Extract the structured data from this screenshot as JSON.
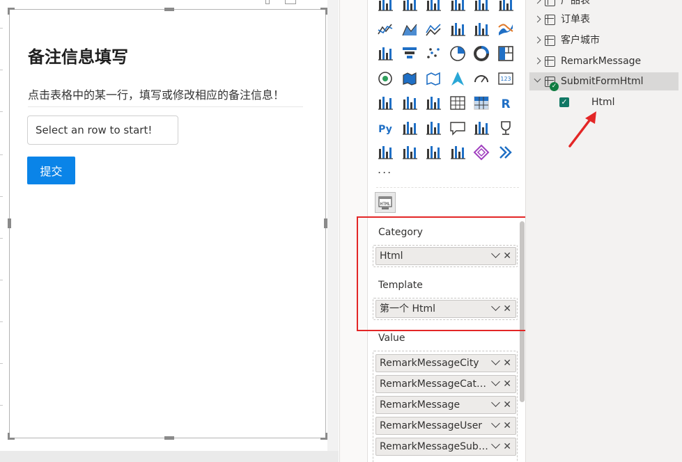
{
  "form": {
    "title": "备注信息填写",
    "instruction": "点击表格中的某一行，填写或修改相应的备注信息！",
    "input_value": "Select an row to start!",
    "submit_label": "提交"
  },
  "visualizations": {
    "more_label": "...",
    "icons": [
      "stacked-bar-icon",
      "stacked-column-icon",
      "clustered-bar-icon",
      "clustered-column-icon",
      "100-bar-icon",
      "100-column-icon",
      "line-chart-icon",
      "area-chart-icon",
      "stacked-area-icon",
      "line-column-icon",
      "line-clustered-column-icon",
      "ribbon-chart-icon",
      "waterfall-icon",
      "funnel-icon",
      "scatter-icon",
      "pie-icon",
      "donut-icon",
      "treemap-icon",
      "map-icon",
      "filled-map-icon",
      "shape-map-icon",
      "azure-map-icon",
      "gauge-icon",
      "card-icon",
      "multi-row-card-icon",
      "kpi-icon",
      "slicer-icon",
      "table-icon",
      "matrix-icon",
      "r-visual-icon",
      "python-visual-icon",
      "key-influencers-icon",
      "decomposition-tree-icon",
      "qa-icon",
      "smart-narrative-icon",
      "goals-icon",
      "paginated-report-icon",
      "power-apps-icon",
      "power-automate-icon",
      "custom-visual-icon",
      "diamond-visual-icon",
      "chevron-visual-icon"
    ],
    "wells": [
      {
        "label": "Category",
        "fields": [
          "Html"
        ]
      },
      {
        "label": "Template",
        "fields": [
          "第一个 Html"
        ]
      },
      {
        "label": "Value",
        "fields": [
          "RemarkMessageCity",
          "RemarkMessageCateg...",
          "RemarkMessage",
          "RemarkMessageUser",
          "RemarkMessageSubm..."
        ]
      }
    ],
    "remove_glyph": "✕"
  },
  "data_pane": {
    "tables": [
      {
        "name": "产品表",
        "expanded": false
      },
      {
        "name": "订单表",
        "expanded": false
      },
      {
        "name": "客户城市",
        "expanded": false
      },
      {
        "name": "RemarkMessage",
        "expanded": false
      },
      {
        "name": "SubmitFormHtml",
        "expanded": true
      }
    ],
    "field": {
      "name": "Html",
      "checked": true
    },
    "check_glyph": "✓"
  },
  "colors": {
    "accent_button": "#0a84e8",
    "highlight_box": "#e32626",
    "check_green": "#117865"
  }
}
